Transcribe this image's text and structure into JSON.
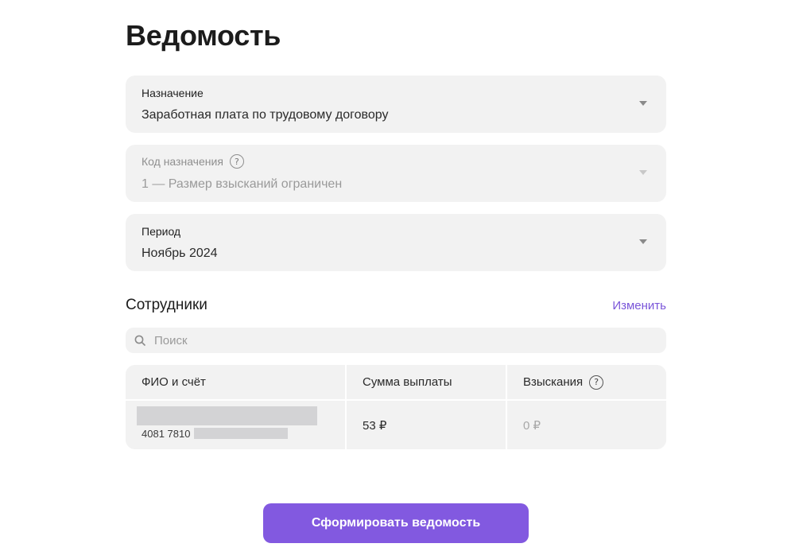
{
  "page": {
    "title": "Ведомость"
  },
  "fields": {
    "purpose": {
      "label": "Назначение",
      "value": "Заработная плата по трудовому договору"
    },
    "purpose_code": {
      "label": "Код назначения",
      "value": "1 — Размер взысканий ограничен",
      "disabled": true
    },
    "period": {
      "label": "Период",
      "value": "Ноябрь 2024"
    }
  },
  "employees": {
    "title": "Сотрудники",
    "edit_label": "Изменить",
    "search_placeholder": "Поиск",
    "columns": {
      "name_account": "ФИО и счёт",
      "amount": "Сумма выплаты",
      "deductions": "Взыскания"
    },
    "rows": [
      {
        "account_prefix": "4081 7810",
        "amount": "53 ₽",
        "deductions": "0 ₽"
      }
    ]
  },
  "submit_label": "Сформировать ведомость",
  "colors": {
    "accent": "#8259e0",
    "link": "#7a55d9",
    "field_bg": "#f2f2f2"
  },
  "icons": {
    "help": "?",
    "search": "search-icon",
    "dropdown": "chevron-down-icon"
  }
}
